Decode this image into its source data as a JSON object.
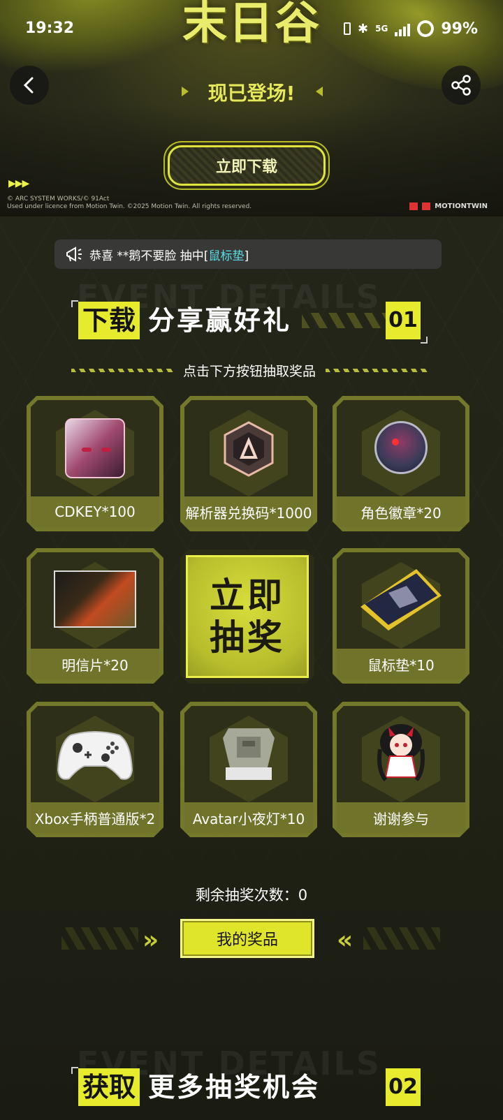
{
  "status_bar": {
    "time": "19:32",
    "signal": "5G",
    "battery": "99%"
  },
  "banner": {
    "logo_text": "末日谷",
    "subtitle": "现已登场!",
    "download_label": "立即下载",
    "copyright_line1": "© ARC SYSTEM WORKS/© 91Act",
    "copyright_line2": "Used under licence from Motion Twin. ©2025 Motion Twin. All rights reserved.",
    "partner_logo": "MOTIONTWIN"
  },
  "notice": {
    "prefix": "恭喜 **鹅不要脸 抽中[",
    "prize": "鼠标垫",
    "suffix": "]"
  },
  "section1": {
    "label": "下载",
    "title": "分享赢好礼",
    "number": "01",
    "bg_text": "EVENT DETAILS",
    "hint": "点击下方按钮抽取奖品"
  },
  "prizes": [
    {
      "label": "CDKEY*100",
      "icon": "character-avatar-icon"
    },
    {
      "label": "解析器兑换码*1000",
      "icon": "analyzer-cube-icon"
    },
    {
      "label": "角色徽章*20",
      "icon": "character-badge-icon"
    },
    {
      "label": "明信片*20",
      "icon": "postcard-icon"
    },
    {
      "label": "鼠标垫*10",
      "icon": "mousepad-icon"
    },
    {
      "label": "Xbox手柄普通版*2",
      "icon": "controller-icon"
    },
    {
      "label": "Avatar小夜灯*10",
      "icon": "night-lamp-icon"
    },
    {
      "label": "谢谢参与",
      "icon": "mascot-girl-icon"
    }
  ],
  "draw_button": {
    "line1": "立即",
    "line2": "抽奖"
  },
  "remaining": "剩余抽奖次数：0",
  "my_prizes_label": "我的奖品",
  "section2": {
    "label": "获取",
    "title": "更多抽奖机会",
    "number": "02",
    "bg_text": "EVENT DETAILS"
  },
  "colors": {
    "accent": "#e6ec2d",
    "card": "#74782a",
    "highlight": "#57e0e8"
  }
}
